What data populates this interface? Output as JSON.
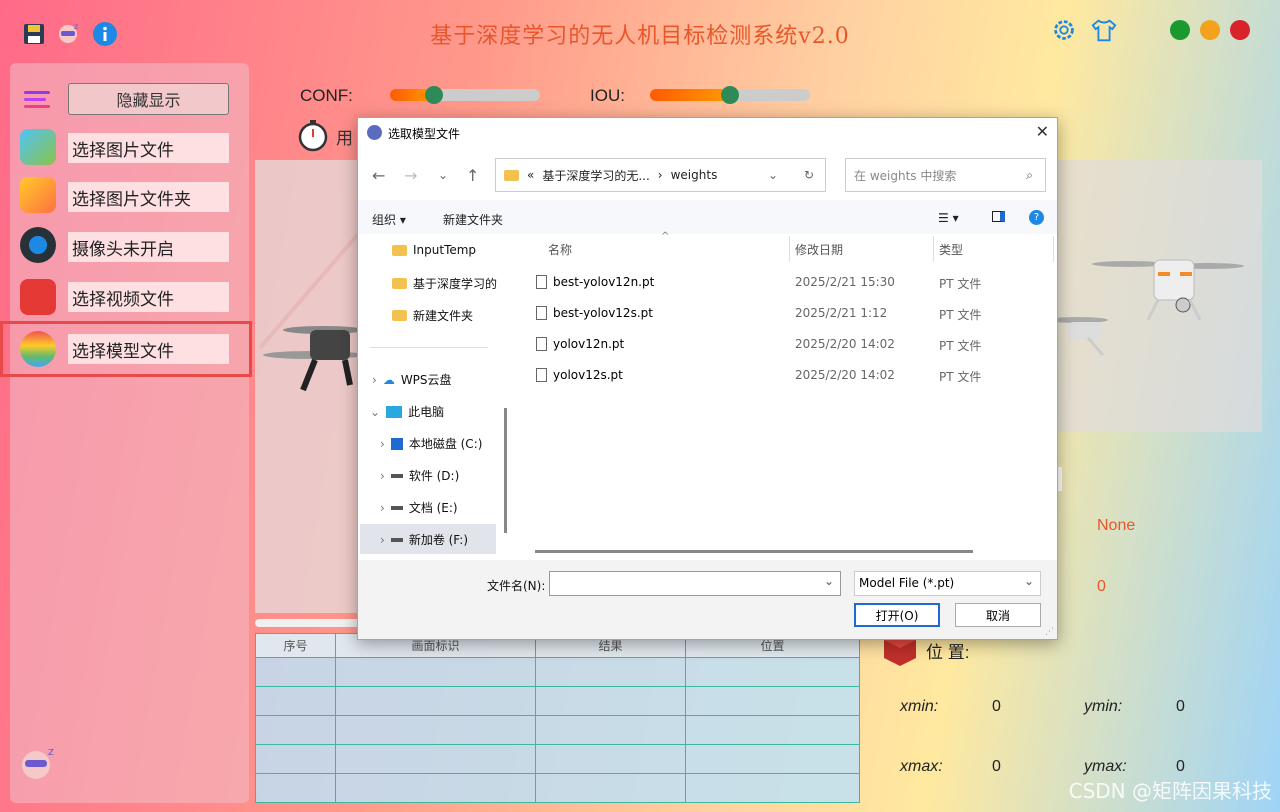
{
  "app": {
    "title": "基于深度学习的无人机目标检测系统v2.0",
    "colors": {
      "title": "#e8562a",
      "dot_green": "#1a9a2e",
      "dot_orange": "#f2a21b",
      "dot_red": "#d8232a"
    }
  },
  "sidebar": {
    "hide_label": "隐藏显示",
    "items": [
      {
        "label": "选择图片文件",
        "icon": "image-icon"
      },
      {
        "label": "选择图片文件夹",
        "icon": "folder-icon"
      },
      {
        "label": "摄像头未开启",
        "icon": "camera-icon"
      },
      {
        "label": "选择视频文件",
        "icon": "video-icon"
      },
      {
        "label": "选择模型文件",
        "icon": "model-icon"
      }
    ]
  },
  "sliders": {
    "conf_label": "CONF:",
    "conf_value": 0.29,
    "iou_label": "IOU:",
    "iou_value": 0.5
  },
  "timer_label": "用",
  "table": {
    "headers": [
      "序号",
      "画面标识",
      "结果",
      "位置"
    ]
  },
  "info": {
    "target_value": "None",
    "count_value": "0",
    "position_label": "位  置:",
    "xmin_label": "xmin:",
    "xmin": "0",
    "ymin_label": "ymin:",
    "ymin": "0",
    "xmax_label": "xmax:",
    "xmax": "0",
    "ymax_label": "ymax:",
    "ymax": "0"
  },
  "dialog": {
    "title": "选取模型文件",
    "breadcrumb": [
      "«",
      "基于深度学习的无...",
      "›",
      "weights"
    ],
    "search_placeholder": "在 weights 中搜索",
    "organize": "组织 ▾",
    "new_folder": "新建文件夹",
    "tree": [
      {
        "label": "InputTemp",
        "type": "folder"
      },
      {
        "label": "基于深度学习的",
        "type": "folder"
      },
      {
        "label": "新建文件夹",
        "type": "folder"
      },
      {
        "label": "WPS云盘",
        "type": "cloud"
      },
      {
        "label": "此电脑",
        "type": "pc"
      },
      {
        "label": "本地磁盘 (C:)",
        "type": "drive"
      },
      {
        "label": "软件 (D:)",
        "type": "drive"
      },
      {
        "label": "文档 (E:)",
        "type": "drive"
      },
      {
        "label": "新加卷 (F:)",
        "type": "drive"
      }
    ],
    "columns": [
      "名称",
      "修改日期",
      "类型"
    ],
    "files": [
      {
        "name": "best-yolov12n.pt",
        "date": "2025/2/21 15:30",
        "type": "PT 文件"
      },
      {
        "name": "best-yolov12s.pt",
        "date": "2025/2/21 1:12",
        "type": "PT 文件"
      },
      {
        "name": "yolov12n.pt",
        "date": "2025/2/20 14:02",
        "type": "PT 文件"
      },
      {
        "name": "yolov12s.pt",
        "date": "2025/2/20 14:02",
        "type": "PT 文件"
      }
    ],
    "filename_label": "文件名(N):",
    "filename_value": "",
    "filter": "Model File (*.pt)",
    "open": "打开(O)",
    "cancel": "取消"
  },
  "watermark": "CSDN @矩阵因果科技"
}
